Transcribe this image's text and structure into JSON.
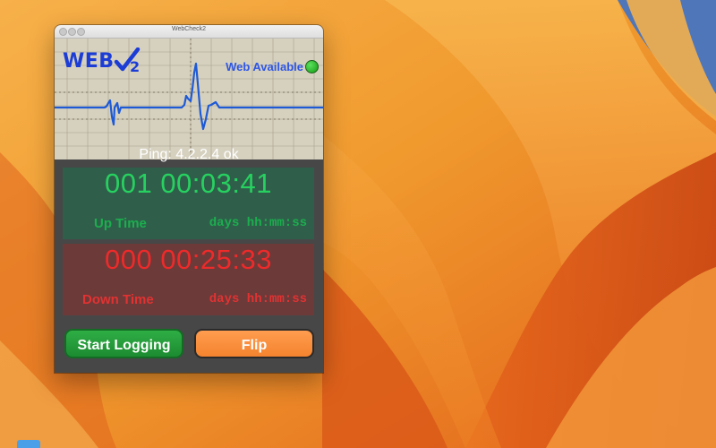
{
  "window": {
    "title": "WebCheck2"
  },
  "logo": {
    "text": "WEB",
    "subscript": "2"
  },
  "status": {
    "text": "Web Available",
    "color": "#22b022"
  },
  "ping": {
    "text": "Ping: 4.2.2.4 ok"
  },
  "uptime": {
    "value": "001 00:03:41",
    "label": "Up Time",
    "units": "days hh:mm:ss"
  },
  "downtime": {
    "value": "000 00:25:33",
    "label": "Down Time",
    "units": "days hh:mm:ss"
  },
  "buttons": {
    "start_logging": "Start Logging",
    "flip": "Flip"
  },
  "colors": {
    "accent_blue": "#1c3cd6",
    "up_green": "#27d160",
    "down_red": "#ee2a2a",
    "flip_orange": "#f4832e",
    "start_green": "#1c8b31"
  }
}
